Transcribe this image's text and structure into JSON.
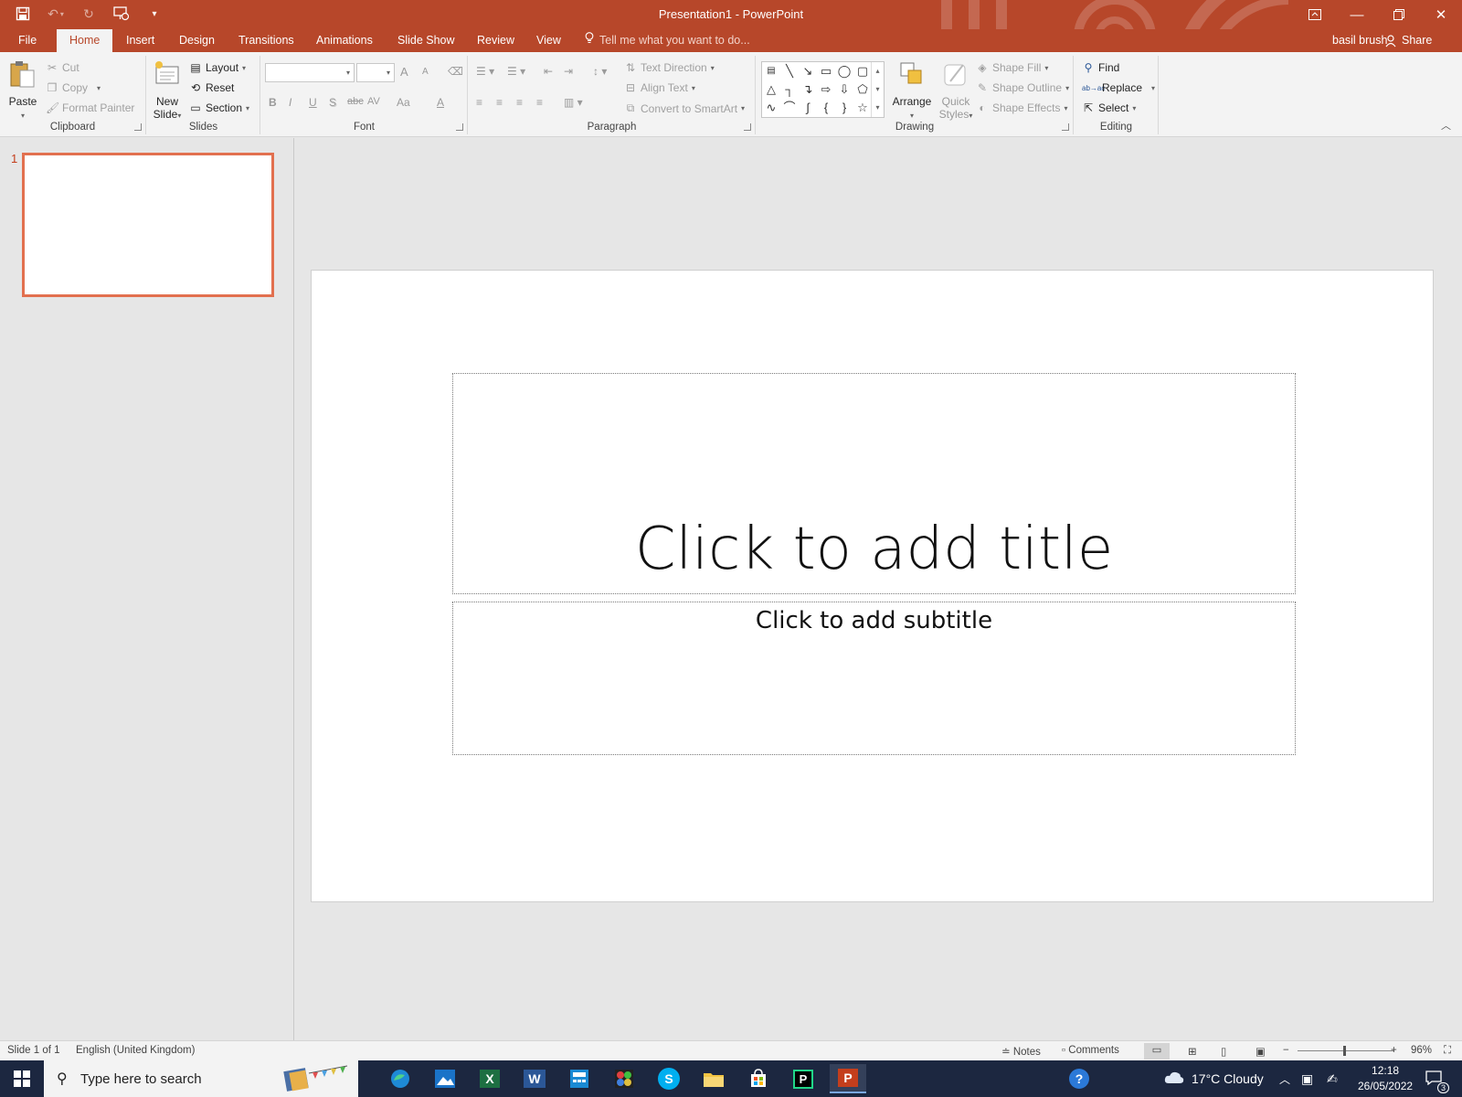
{
  "window": {
    "title": "Presentation1 - PowerPoint",
    "user_name": "basil brush",
    "share_label": "Share"
  },
  "tabs": [
    {
      "label": "File"
    },
    {
      "label": "Home"
    },
    {
      "label": "Insert"
    },
    {
      "label": "Design"
    },
    {
      "label": "Transitions"
    },
    {
      "label": "Animations"
    },
    {
      "label": "Slide Show"
    },
    {
      "label": "Review"
    },
    {
      "label": "View"
    }
  ],
  "tell_me": "Tell me what you want to do...",
  "ribbon": {
    "clipboard": {
      "label": "Clipboard",
      "paste": "Paste",
      "cut": "Cut",
      "copy": "Copy",
      "format_painter": "Format Painter"
    },
    "slides": {
      "label": "Slides",
      "new_slide_1": "New",
      "new_slide_2": "Slide",
      "layout": "Layout",
      "reset": "Reset",
      "section": "Section"
    },
    "font": {
      "label": "Font",
      "bold": "B",
      "italic": "I",
      "underline": "U",
      "shadow": "S",
      "strike": "abc",
      "spacing": "AV",
      "case": "Aa",
      "color": "A",
      "grow": "A",
      "shrink": "A"
    },
    "paragraph": {
      "label": "Paragraph",
      "text_direction": "Text Direction",
      "align_text": "Align Text",
      "convert_smartart": "Convert to SmartArt"
    },
    "drawing": {
      "label": "Drawing",
      "arrange": "Arrange",
      "quick_styles_1": "Quick",
      "quick_styles_2": "Styles",
      "shape_fill": "Shape Fill",
      "shape_outline": "Shape Outline",
      "shape_effects": "Shape Effects"
    },
    "editing": {
      "label": "Editing",
      "find": "Find",
      "replace": "Replace",
      "select": "Select",
      "replace_icon": "ab→ac"
    }
  },
  "thumbnails": [
    {
      "number": "1"
    }
  ],
  "slide": {
    "title_placeholder": "Click to add title",
    "subtitle_placeholder": "Click to add subtitle"
  },
  "status": {
    "slide_info": "Slide 1 of 1",
    "language": "English (United Kingdom)",
    "notes": "Notes",
    "comments": "Comments",
    "zoom": "96%",
    "zoom_fraction": 0.48
  },
  "taskbar": {
    "search_placeholder": "Type here to search",
    "weather": "17°C  Cloudy",
    "time": "12:18",
    "date": "26/05/2022",
    "notification_count": "3",
    "apps": [
      {
        "name": "edge-icon"
      },
      {
        "name": "photos-icon"
      },
      {
        "name": "excel-icon",
        "label": "X"
      },
      {
        "name": "word-icon",
        "label": "W"
      },
      {
        "name": "calculator-icon"
      },
      {
        "name": "paint-icon"
      },
      {
        "name": "skype-icon",
        "label": "S"
      },
      {
        "name": "file-explorer-icon"
      },
      {
        "name": "store-icon"
      },
      {
        "name": "pycharm-icon",
        "label": "P"
      },
      {
        "name": "powerpoint-icon",
        "label": "P"
      }
    ]
  },
  "colors": {
    "accent": "#b7472a",
    "selection": "#e2704f",
    "taskbar": "#1c2740"
  }
}
